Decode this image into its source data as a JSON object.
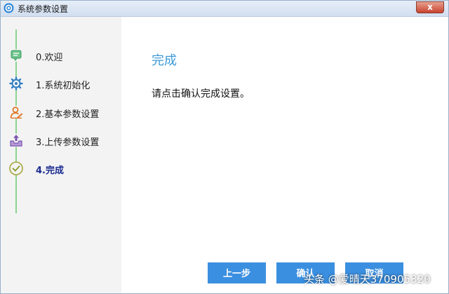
{
  "window": {
    "title": "系统参数设置",
    "close_label": "x"
  },
  "sidebar": {
    "steps": [
      {
        "label": "0.欢迎",
        "icon": "message-icon",
        "active": false
      },
      {
        "label": "1.系统初始化",
        "icon": "gear-icon",
        "active": false
      },
      {
        "label": "2.基本参数设置",
        "icon": "user-edit-icon",
        "active": false
      },
      {
        "label": "3.上传参数设置",
        "icon": "upload-icon",
        "active": false
      },
      {
        "label": "4.完成",
        "icon": "check-circle-icon",
        "active": true
      }
    ]
  },
  "main": {
    "heading": "完成",
    "message": "请点击确认完成设置。"
  },
  "buttons": {
    "prev": "上一步",
    "confirm": "确认",
    "cancel": "取消"
  },
  "watermark": "头条 @爱晴天370905320",
  "colors": {
    "accent": "#3b8fe0",
    "heading": "#3d9ad6",
    "active_step": "#1a2b8f",
    "timeline": "#8fd38f"
  }
}
